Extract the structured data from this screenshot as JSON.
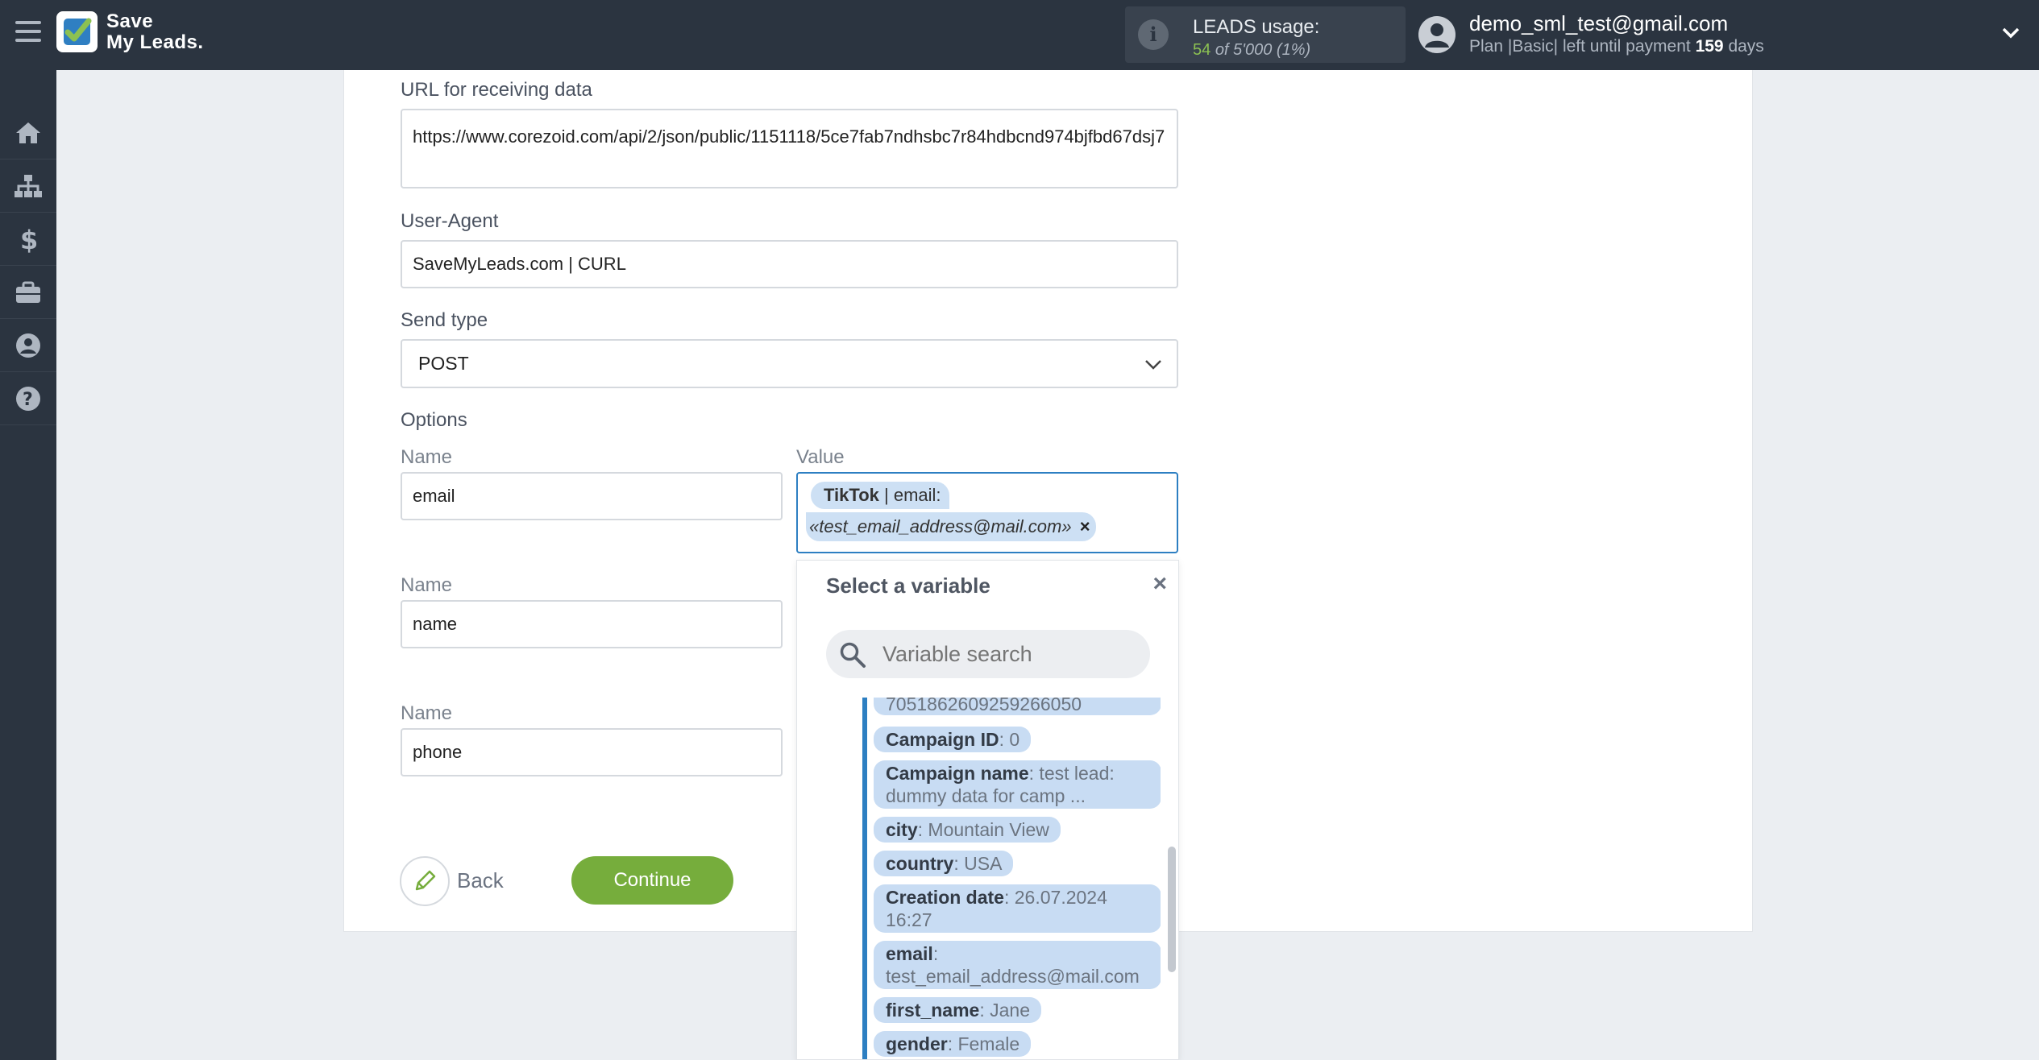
{
  "header": {
    "logo_line1": "Save",
    "logo_line2": "My Leads.",
    "usage_label": "LEADS usage:",
    "usage_used": "54",
    "usage_of": "of 5'000",
    "usage_percent": "(1%)",
    "user_email": "demo_sml_test@gmail.com",
    "plan_prefix": "Plan |Basic| left until payment",
    "plan_days": "159",
    "plan_suffix": "days"
  },
  "sidebar": {
    "items": [
      {
        "icon": "home-icon"
      },
      {
        "icon": "sitemap-icon"
      },
      {
        "icon": "dollar-icon"
      },
      {
        "icon": "briefcase-icon"
      },
      {
        "icon": "user-circle-icon"
      },
      {
        "icon": "help-icon"
      }
    ]
  },
  "form": {
    "url_label": "URL for receiving data",
    "url_value": "https://www.corezoid.com/api/2/json/public/1151118/5ce7fab7ndhsbc7r84hdbcnd974bjfbd67dsj7",
    "user_agent_label": "User-Agent",
    "user_agent_value": "SaveMyLeads.com | CURL",
    "send_type_label": "Send type",
    "send_type_value": "POST",
    "options_label": "Options",
    "name_label": "Name",
    "value_label": "Value",
    "rows": [
      {
        "name": "email"
      },
      {
        "name": "name"
      },
      {
        "name": "phone"
      }
    ],
    "value_chip": {
      "source": "TikTok",
      "field": "| email:",
      "sample": "«test_email_address@mail.com»",
      "remove": "×"
    },
    "back_label": "Back",
    "continue_label": "Continue"
  },
  "variable_dropdown": {
    "title": "Select a variable",
    "close": "×",
    "search_placeholder": "Variable search",
    "items": [
      {
        "key": "",
        "value": "7051862609259266050"
      },
      {
        "key": "Campaign ID",
        "value": ": 0"
      },
      {
        "key": "Campaign name",
        "value": ": test lead:",
        "value2": "dummy data for camp ..."
      },
      {
        "key": "city",
        "value": ": Mountain View"
      },
      {
        "key": "country",
        "value": ": USA"
      },
      {
        "key": "Creation date",
        "value": ": 26.07.2024",
        "value2": "16:27"
      },
      {
        "key": "email",
        "value": ":",
        "value2": "test_email_address@mail.com"
      },
      {
        "key": "first_name",
        "value": ": Jane"
      },
      {
        "key": "gender",
        "value": ": Female"
      }
    ]
  },
  "colors": {
    "topbar": "#2b3440",
    "accent_blue": "#2d7fc2",
    "continue_green": "#76ad3c",
    "chip_blue": "#c8dcf3"
  }
}
